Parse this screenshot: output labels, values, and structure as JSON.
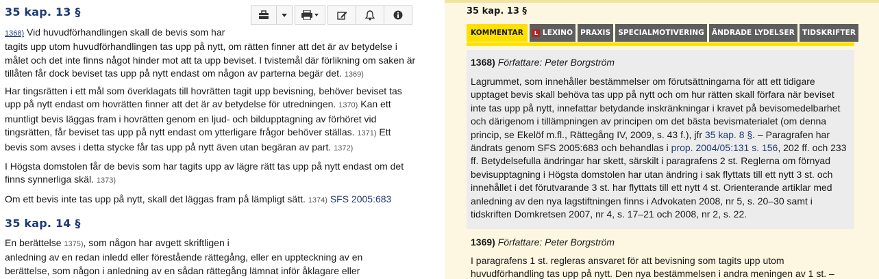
{
  "left": {
    "section13_title": "35 kap. 13 §",
    "section14_title": "35 kap. 14 §",
    "toolbar": {
      "briefcase_icon": "briefcase-icon",
      "dropdown_icon": "caret-down-icon",
      "print_icon": "print-icon",
      "edit_icon": "edit-icon",
      "bell_icon": "bell-icon",
      "info_icon": "info-icon"
    },
    "p1": {
      "ref": "1368)",
      "line1": " Vid huvudförhandlingen skall de bevis som har",
      "rest": "tagits upp utom huvudförhandlingen tas upp på nytt, om rätten finner att det är av betydelse i målet och det inte finns något hinder mot att ta upp beviset. I tvistemål där förlikning om saken är tillåten får dock beviset tas upp på nytt endast om någon av parterna begär det.",
      "end_ref": "1369)"
    },
    "p2": {
      "t1": "Har tingsrätten i ett mål som överklagats till hovrätten tagit upp bevisning, behöver beviset tas upp på nytt endast om hovrätten finner att det är av betydelse för utredningen.",
      "r1": "1370)",
      "t2": " Kan ett muntligt bevis läggas fram i hovrätten genom en ljud- och bildupptagning av förhöret vid tingsrätten, får beviset tas upp på nytt endast om ytterligare frågor behöver ställas.",
      "r2": "1371)",
      "t3": " Ett bevis som avses i detta stycke får tas upp på nytt även utan begäran av part.",
      "r3": "1372)"
    },
    "p3": {
      "t": "I Högsta domstolen får de bevis som har tagits upp av lägre rätt tas upp på nytt endast om det finns synnerliga skäl.",
      "r": "1373)"
    },
    "p4": {
      "t": "Om ett bevis inte tas upp på nytt, skall det läggas fram på lämpligt sätt.",
      "r": "1374)",
      "link": "SFS 2005:683"
    },
    "p5": {
      "t1": "En berättelse",
      "r1": "1375)",
      "t2": ", som någon har avgett skriftligen i",
      "t3": "anledning av en redan inledd eller förestående rättegång, eller en uppteckning av en",
      "t4": "berättelse, som någon i anledning av en sådan rättegång lämnat inför åklagare eller"
    }
  },
  "right": {
    "title": "35 kap. 13 §",
    "tabs": [
      "KOMMENTAR",
      "LEXINO",
      "PRAXIS",
      "SPECIALMOTIVERING",
      "ÄNDRADE LYDELSER",
      "TIDSKRIFTER"
    ],
    "lexino_mark": "L",
    "comment1": {
      "num": "1368)",
      "author": "Författare: Peter Borgström",
      "t1": "Lagrummet, som innehåller bestämmelser om förutsättningarna för att ett tidigare upptaget bevis skall behöva tas upp på nytt och om hur rätten skall förfara när beviset inte tas upp på nytt, innefattar betydande inskränkningar i kravet på bevisomedelbarhet och därigenom i tillämpningen av principen om det bästa bevismaterialet (om denna princip, se Ekelöf m.fl., Rättegång IV, 2009, s. 43 f.), jfr ",
      "link1": "35 kap. 8 §",
      "t2": ". – Paragrafen har ändrats genom SFS 2005:683 och behandlas i ",
      "link2": "prop. 2004/05:131 s. 156",
      "t3": ", 202 ff. och 233 ff. Betydelsefulla ändringar har skett, särskilt i paragrafens 2 st. Reglerna om förnyad bevisupptagning i Högsta domstolen har utan ändring i sak flyttats till ett nytt 3 st. och innehållet i det förutvarande 3 st. har flyttats till ett nytt 4 st. Orienterande artiklar med anledning av den nya lagstiftningen finns i Advokaten 2008, nr 5, s. 20–30 samt i tidskriften Domkretsen 2007, nr 4, s. 17–21 och 2008, nr 2, s. 22."
    },
    "comment2": {
      "num": "1369)",
      "author": "Författare: Peter Borgström",
      "t": "I paragrafens 1 st. regleras ansvaret för att bevisning som tagits upp utom huvudförhandling tas upp på nytt. Den nya bestämmelsen i andra meningen av 1 st. –"
    }
  }
}
